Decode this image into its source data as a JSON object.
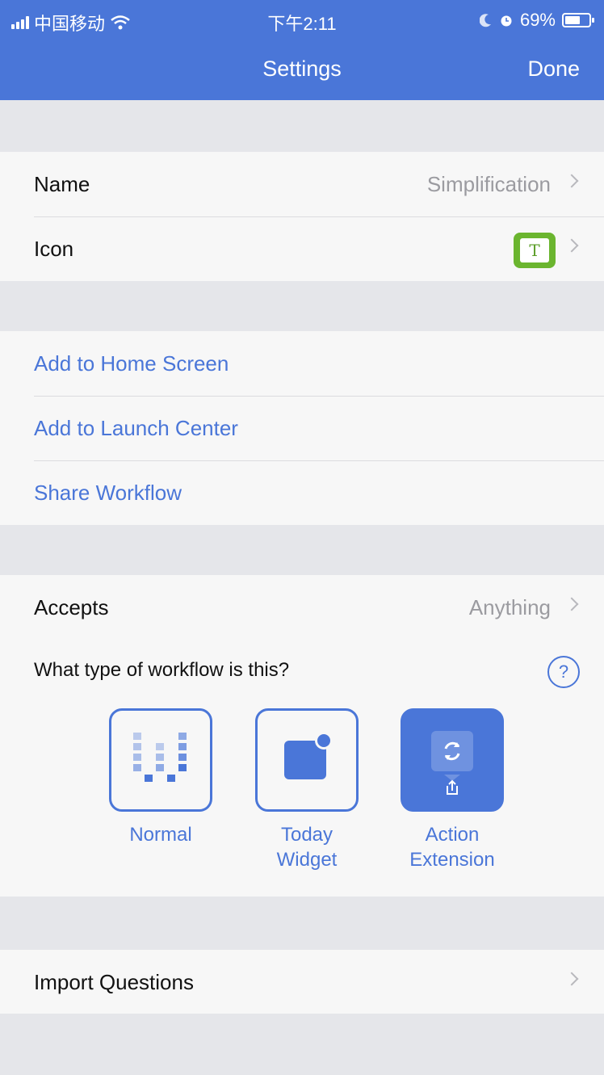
{
  "status_bar": {
    "carrier": "中国移动",
    "time": "下午2:11",
    "battery": "69%"
  },
  "nav": {
    "title": "Settings",
    "done_label": "Done"
  },
  "general": {
    "name_label": "Name",
    "name_value": "Simplification",
    "icon_label": "Icon",
    "icon_glyph": "T",
    "icon_color": "#6bb52f"
  },
  "actions": {
    "items": [
      {
        "label": "Add to Home Screen"
      },
      {
        "label": "Add to Launch Center"
      },
      {
        "label": "Share Workflow"
      }
    ]
  },
  "workflow": {
    "accepts_label": "Accepts",
    "accepts_value": "Anything",
    "question": "What type of workflow is this?",
    "help_glyph": "?",
    "types": [
      {
        "label_line1": "Normal",
        "label_line2": "",
        "selected": false
      },
      {
        "label_line1": "Today",
        "label_line2": "Widget",
        "selected": false
      },
      {
        "label_line1": "Action",
        "label_line2": "Extension",
        "selected": true
      }
    ]
  },
  "import": {
    "label": "Import Questions"
  },
  "colors": {
    "accent": "#4a76d8",
    "background": "#e5e6ea",
    "cell": "#f7f7f7"
  }
}
